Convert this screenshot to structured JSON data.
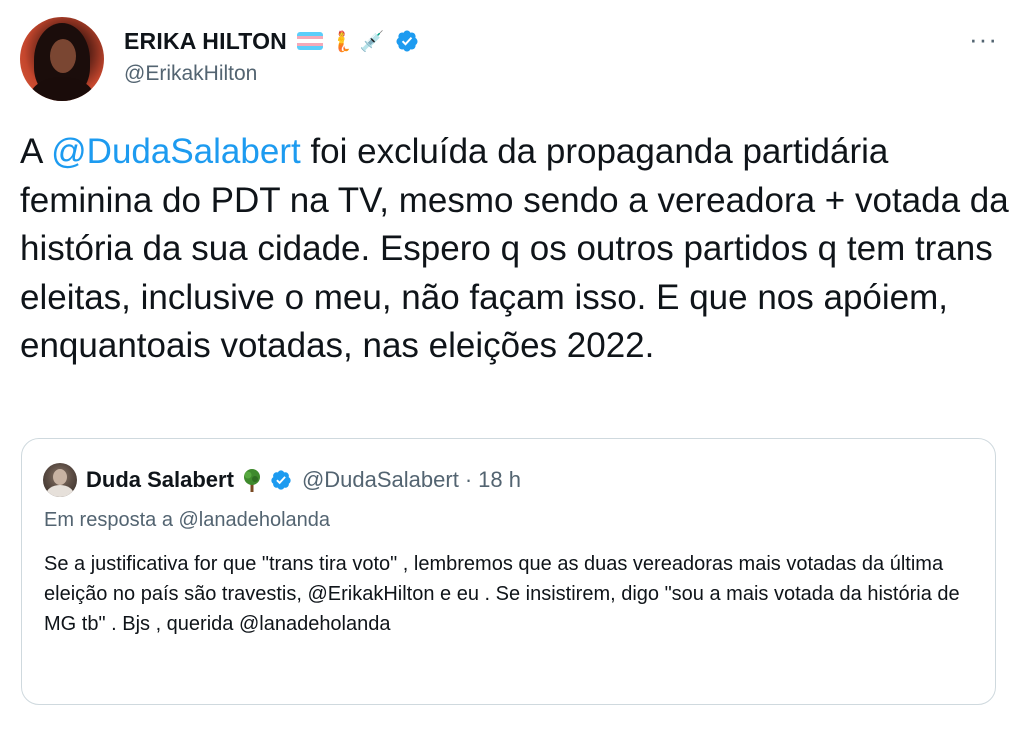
{
  "tweet": {
    "display_name": "ERIKA HILTON",
    "name_emojis": {
      "mermaid": "🧜",
      "syringe": "💉"
    },
    "handle": "@ErikakHilton",
    "more_label": "···",
    "body": {
      "prefix": "A ",
      "mention": "@DudaSalabert",
      "text": " foi excluída da propaganda partidária feminina do PDT na TV, mesmo sendo a vereadora + votada da história da sua cidade. Espero q os outros partidos q tem trans eleitas, inclusive o meu, não façam isso. E que nos apóiem, enquantoais votadas, nas eleições 2022."
    }
  },
  "quote": {
    "display_name": "Duda Salabert",
    "name_emoji": "tree-icon",
    "handle": "@DudaSalabert",
    "separator": "·",
    "time": "18 h",
    "reply_to": "Em resposta a @lanadeholanda",
    "text": "Se a justificativa for que \"trans tira voto\" , lembremos que as duas vereadoras mais votadas da última eleição no país são travestis,  @ErikakHilton e eu . Se insistirem, digo \"sou a mais votada da história de MG tb\" . Bjs , querida @lanadeholanda"
  },
  "colors": {
    "accent": "#1d9bf0",
    "secondary_text": "#536471",
    "border": "#cfd9de",
    "flag_blue": "#5bcefa",
    "flag_pink": "#f5a9b8",
    "flag_white": "#ffffff"
  }
}
